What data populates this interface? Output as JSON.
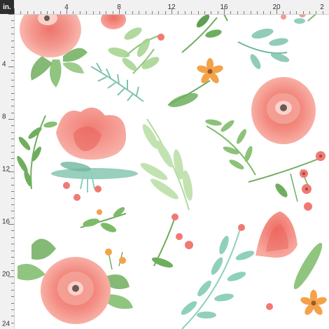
{
  "ruler": {
    "unit_label": "in.",
    "top_labels": [
      "4",
      "8",
      "12",
      "16",
      "20",
      "2"
    ],
    "left_labels": [
      "4",
      "8",
      "12",
      "16",
      "20",
      "24"
    ]
  },
  "pattern": {
    "description_icon": "watercolor-floral-pattern",
    "colors": {
      "rose": "#f2837a",
      "rose_light": "#f7b3a8",
      "leaf_green": "#6fae5e",
      "leaf_mint": "#8fd0bd",
      "leaf_light": "#b8dfa4",
      "orange": "#f4a24a",
      "center": "#6b5a52"
    }
  }
}
